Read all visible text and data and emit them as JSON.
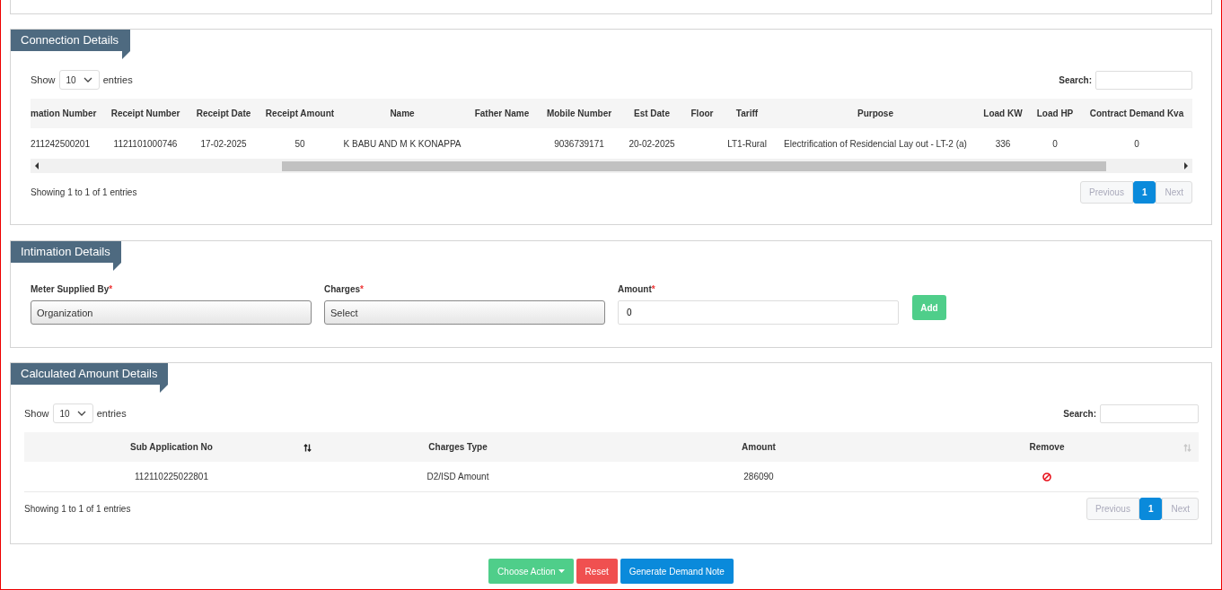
{
  "connection_details": {
    "title": "Connection Details",
    "length_menu": {
      "label_before": "Show",
      "value": "10",
      "label_after": "entries"
    },
    "search": {
      "label": "Search:"
    },
    "table": {
      "columns": [
        "mation Number",
        "Receipt Number",
        "Receipt Date",
        "Receipt Amount",
        "Name",
        "Father Name",
        "Mobile Number",
        "Est Date",
        "Floor",
        "Tariff",
        "Purpose",
        "Load KW",
        "Load HP",
        "Contract Demand Kva"
      ],
      "rows": [
        [
          "211242500201",
          "1121101000746",
          "17-02-2025",
          "50",
          "K BABU AND M K KONAPPA",
          "",
          "9036739171",
          "20-02-2025",
          "",
          "LT1-Rural",
          "Electrification of Residencial Lay out - LT-2 (a)",
          "336",
          "0",
          "0"
        ]
      ]
    },
    "info": "Showing 1 to 1 of 1 entries",
    "pagination": [
      {
        "label": "Previous",
        "kind": "nav",
        "disabled": true,
        "selected": false
      },
      {
        "label": "1",
        "kind": "page",
        "disabled": false,
        "selected": true
      },
      {
        "label": "Next",
        "kind": "nav",
        "disabled": true,
        "selected": false
      }
    ]
  },
  "intimation_details": {
    "title": "Intimation Details",
    "fields": [
      {
        "label": "Meter Supplied By",
        "required_mark": "*",
        "kind": "select",
        "value": "Organization"
      },
      {
        "label": "Charges",
        "required_mark": "*",
        "kind": "select",
        "value": "Select"
      },
      {
        "label": "Amount",
        "required_mark": "*",
        "kind": "input",
        "value": "0"
      }
    ],
    "add_button": "Add"
  },
  "calculated_amount_details": {
    "title": "Calculated Amount Details",
    "length_menu": {
      "label_before": "Show",
      "value": "10",
      "label_after": "entries"
    },
    "search": {
      "label": "Search:"
    },
    "table": {
      "columns": [
        {
          "label": "Sub Application No",
          "sortable": true,
          "sort_active": true
        },
        {
          "label": "Charges Type",
          "sortable": false
        },
        {
          "label": "Amount",
          "sortable": false
        },
        {
          "label": "Remove",
          "sortable": true,
          "sort_active": false
        }
      ],
      "rows": [
        [
          {
            "kind": "text",
            "text": "112110225022801"
          },
          {
            "kind": "text",
            "text": "D2/ISD Amount"
          },
          {
            "kind": "text",
            "text": "286090"
          },
          {
            "kind": "remove"
          }
        ]
      ]
    },
    "info": "Showing 1 to 1 of 1 entries",
    "pagination": [
      {
        "label": "Previous",
        "kind": "nav",
        "disabled": true,
        "selected": false
      },
      {
        "label": "1",
        "kind": "page",
        "disabled": false,
        "selected": true
      },
      {
        "label": "Next",
        "kind": "nav",
        "disabled": true,
        "selected": false
      }
    ]
  },
  "actions": [
    {
      "label": "Choose Action",
      "kind": "dropdown"
    },
    {
      "label": "Reset",
      "kind": "danger"
    },
    {
      "label": "Generate Demand Note",
      "kind": "primary"
    }
  ]
}
